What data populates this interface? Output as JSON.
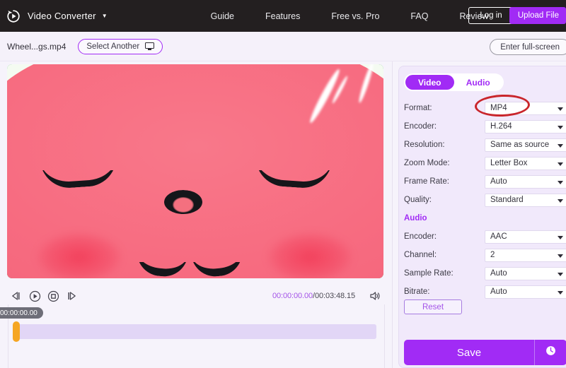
{
  "topnav": {
    "brand": "Video Converter",
    "brand_caret": "▼",
    "logo_icon": "play-circle-refresh-logo",
    "links": [
      {
        "label": "Guide"
      },
      {
        "label": "Features"
      },
      {
        "label": "Free vs. Pro"
      },
      {
        "label": "FAQ"
      },
      {
        "label": "Review"
      }
    ],
    "login_label": "Log in",
    "upload_label": "Upload File",
    "bg_color": "#231f20",
    "accent_color": "#a12bf5"
  },
  "subbar": {
    "filename": "Wheel...gs.mp4",
    "select_another_label": "Select Another",
    "select_another_icon": "monitor-icon",
    "fullscreen_label": "Enter full-screen"
  },
  "player": {
    "preview_description": "watermelon-character-face",
    "controls": [
      {
        "name": "previous-frame",
        "icon": "step-backward-icon"
      },
      {
        "name": "play",
        "icon": "play-circle-icon"
      },
      {
        "name": "stop",
        "icon": "stop-circle-icon"
      },
      {
        "name": "next-frame",
        "icon": "step-forward-icon"
      }
    ],
    "current_time": "00:00:00.00",
    "time_separator": "/",
    "total_time": "00:03:48.15",
    "volume_icon": "speaker-icon",
    "timeline_tooltip": "00:00:00.00",
    "playhead_color": "#f5a623",
    "track_color": "#e2d6f6"
  },
  "panel": {
    "tabs": [
      {
        "label": "Video",
        "active": true
      },
      {
        "label": "Audio",
        "active": false
      }
    ],
    "video_settings": [
      {
        "label": "Format:",
        "value": "MP4"
      },
      {
        "label": "Encoder:",
        "value": "H.264"
      },
      {
        "label": "Resolution:",
        "value": "Same as source"
      },
      {
        "label": "Zoom Mode:",
        "value": "Letter Box"
      },
      {
        "label": "Frame Rate:",
        "value": "Auto"
      },
      {
        "label": "Quality:",
        "value": "Standard"
      }
    ],
    "audio_section_title": "Audio",
    "audio_settings": [
      {
        "label": "Encoder:",
        "value": "AAC"
      },
      {
        "label": "Channel:",
        "value": "2"
      },
      {
        "label": "Sample Rate:",
        "value": "Auto"
      },
      {
        "label": "Bitrate:",
        "value": "Auto"
      }
    ],
    "reset_label": "Reset",
    "save_label": "Save",
    "save_side_icon": "clock-history-icon",
    "annotation": {
      "shape": "ellipse",
      "color": "#c9252b",
      "targets": "format-value"
    }
  }
}
